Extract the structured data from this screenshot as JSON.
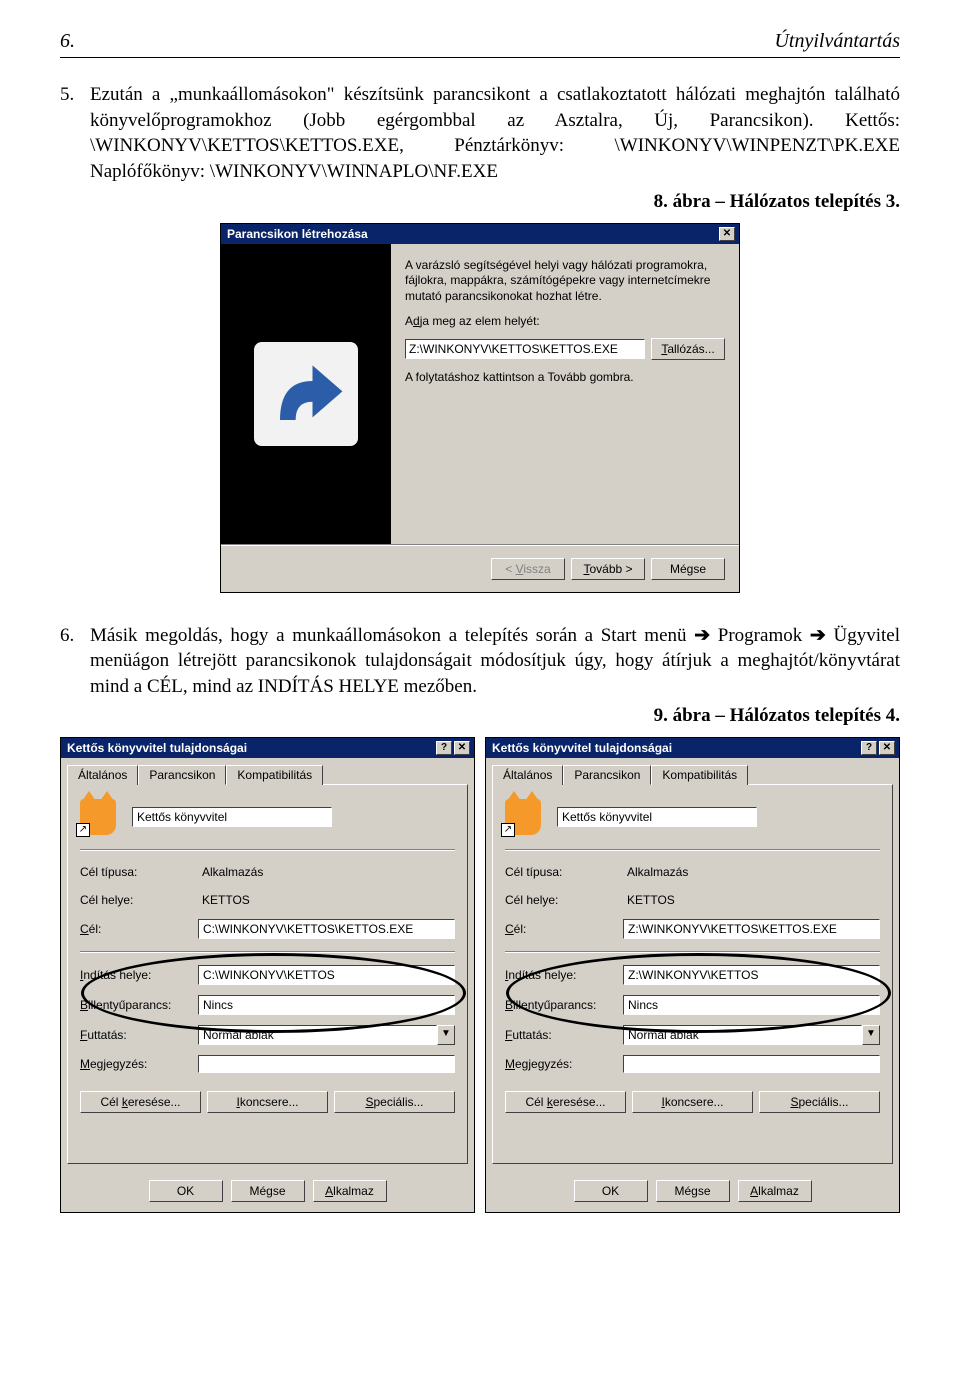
{
  "header": {
    "page_num": "6.",
    "title": "Útnyilvántartás"
  },
  "para5": {
    "num": "5.",
    "text": "Ezután a „munkaállomásokon\" készítsünk parancsikont a csatlakoztatott hálózati meghajtón található könyvelőprogramokhoz (Jobb egérgombbal az Asztalra, Új, Parancsikon). Kettős: \\WINKONYV\\KETTOS\\KETTOS.EXE, Pénztárkönyv: \\WINKONYV\\WINPENZT\\PK.EXE Naplófőkönyv: \\WINKONYV\\WINNAPLO\\NF.EXE"
  },
  "fig8": "8. ábra – Hálózatos telepítés 3.",
  "wizard": {
    "title": "Parancsikon létrehozása",
    "help": "A varázsló segítségével helyi vagy hálózati programokra, fájlokra, mappákra, számítógépekre vagy internetcímekre mutató parancsikonokat hozhat létre.",
    "lbl_path_pre": "A",
    "lbl_path_u": "d",
    "lbl_path_post": "ja meg az elem helyét:",
    "path_value": "Z:\\WINKONYV\\KETTOS\\KETTOS.EXE",
    "browse_u": "T",
    "browse_post": "allózás...",
    "continue": "A folytatáshoz kattintson a Tovább gombra.",
    "back_pre": "< ",
    "back_u": "V",
    "back_post": "issza",
    "next_u": "T",
    "next_post": "ovább >",
    "cancel": "Mégse"
  },
  "para6": {
    "num": "6.",
    "pre": "Másik megoldás, hogy a munkaállomásokon a telepítés során a Start menü ",
    "arrow1": "➔",
    "mid1": " Programok ",
    "arrow2": "➔",
    "post": " Ügyvitel menüágon létrejött parancsikonok tulajdonságait módosítjuk úgy, hogy átírjuk a meghajtót/könyvtárat mind a CÉL, mind az INDÍTÁS HELYE mezőben."
  },
  "fig9": "9. ábra – Hálózatos telepítés 4.",
  "tabs": {
    "general": "Általános",
    "shortcut": "Parancsikon",
    "compat": "Kompatibilitás"
  },
  "prop": {
    "title": "Kettős könyvvitel tulajdonságai",
    "caption": "Kettős könyvvitel",
    "type_label": "Cél típusa:",
    "type_val": "Alkalmazás",
    "loc_label": "Cél helye:",
    "loc_val": "KETTOS",
    "target_u": "C",
    "target_post": "él:",
    "start_u": "I",
    "start_post": "ndítás helye:",
    "key_u": "B",
    "key_post": "illentyűparancs:",
    "key_val": "Nincs",
    "run_u": "F",
    "run_post": "uttatás:",
    "run_val": "Normál ablak",
    "comment_u": "M",
    "comment_post": "egjegyzés:",
    "find_pre": "Cél ",
    "find_u": "k",
    "find_post": "eresése...",
    "icon_u": "I",
    "icon_post": "koncsere...",
    "adv_u": "S",
    "adv_post": "peciális...",
    "ok": "OK",
    "cancel": "Mégse",
    "apply_u": "A",
    "apply_post": "lkalmaz"
  },
  "left": {
    "target": "C:\\WINKONYV\\KETTOS\\KETTOS.EXE",
    "start": "C:\\WINKONYV\\KETTOS"
  },
  "right": {
    "target": "Z:\\WINKONYV\\KETTOS\\KETTOS.EXE",
    "start": "Z:\\WINKONYV\\KETTOS"
  }
}
